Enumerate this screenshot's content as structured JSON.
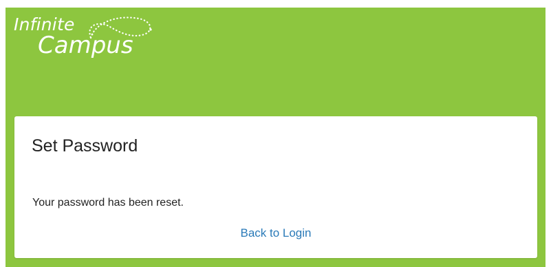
{
  "header": {
    "logo_top": "Infinite",
    "logo_bottom": "Campus",
    "background_color": "#8dc63f"
  },
  "card": {
    "title": "Set Password",
    "message": "Your password has been reset.",
    "back_link_label": "Back to Login",
    "link_color": "#2a7ab8"
  }
}
